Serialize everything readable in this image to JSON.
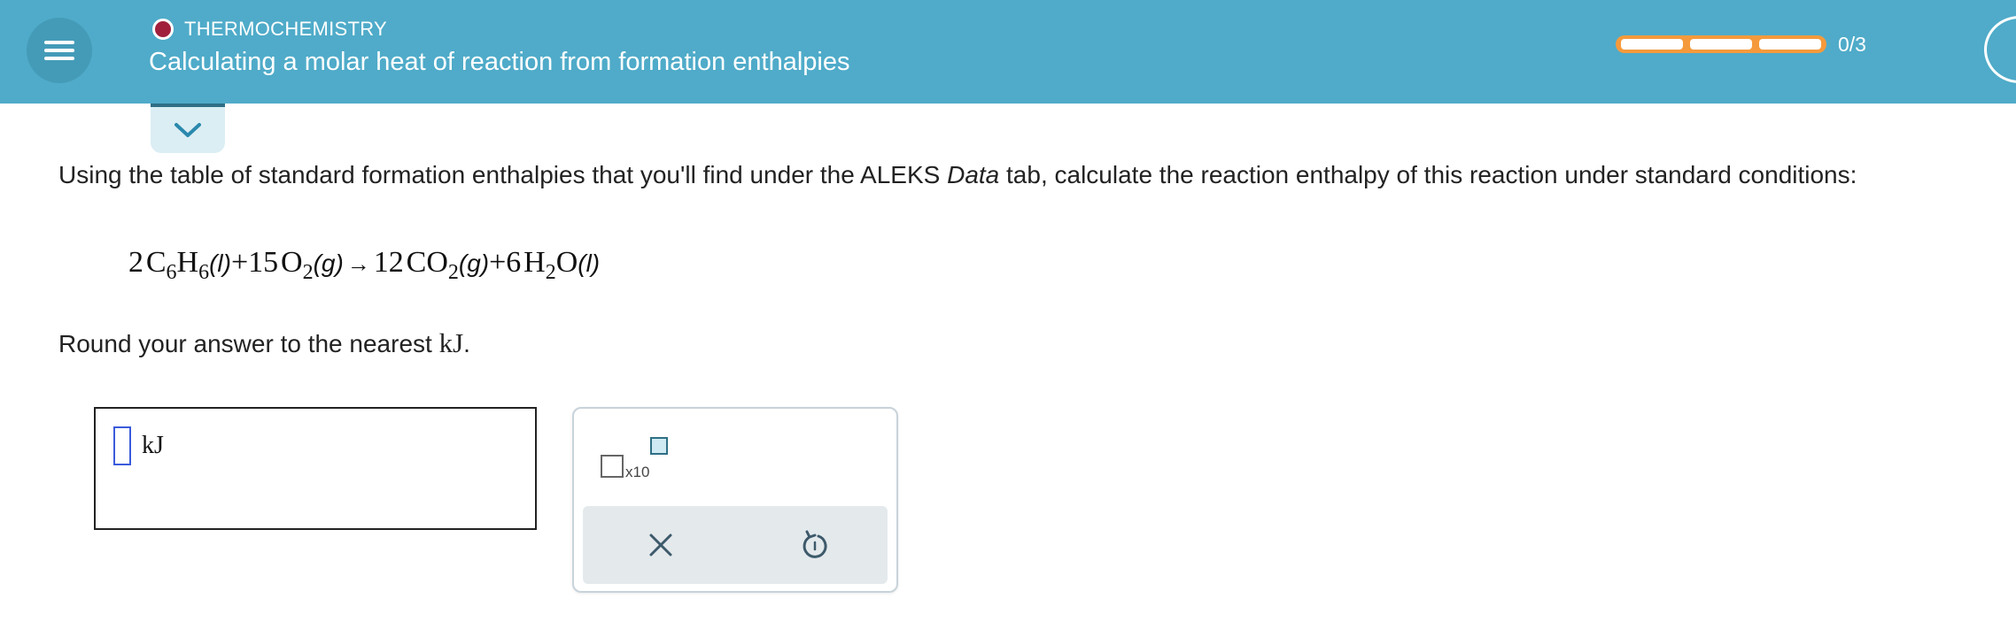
{
  "header": {
    "topic": "THERMOCHEMISTRY",
    "title": "Calculating a molar heat of reaction from formation enthalpies",
    "progress": {
      "completed": 0,
      "total": 3,
      "label": "0/3"
    },
    "colors": {
      "background": "#4fabc9",
      "progress": "#f59a3c",
      "topic_dot": "#a0203c"
    }
  },
  "question": {
    "intro_before": "Using the table of standard formation enthalpies that you'll find under the ALEKS ",
    "intro_italic": "Data",
    "intro_after": " tab, calculate the reaction enthalpy of this reaction under standard conditions:",
    "equation": {
      "r1_coef": "2",
      "r1_a": "C",
      "r1_a_sub": "6",
      "r1_b": "H",
      "r1_b_sub": "6",
      "r1_phase": "(l)",
      "plus1": "+",
      "r2_coef": "15",
      "r2_a": "O",
      "r2_a_sub": "2",
      "r2_phase": "(g)",
      "arrow": "→",
      "p1_coef": "12",
      "p1_a": "CO",
      "p1_a_sub": "2",
      "p1_phase": "(g)",
      "plus2": "+",
      "p2_coef": "6",
      "p2_a": "H",
      "p2_a_sub": "2",
      "p2_b": "O",
      "p2_phase": "(l)"
    },
    "round_before": "Round your answer to the nearest ",
    "round_unit": "kJ",
    "round_after": "."
  },
  "answer": {
    "value": "",
    "unit": "kJ"
  },
  "palette": {
    "sci_label": "x10",
    "icons": [
      "scientific-notation-icon",
      "clear-icon",
      "undo-icon"
    ]
  }
}
